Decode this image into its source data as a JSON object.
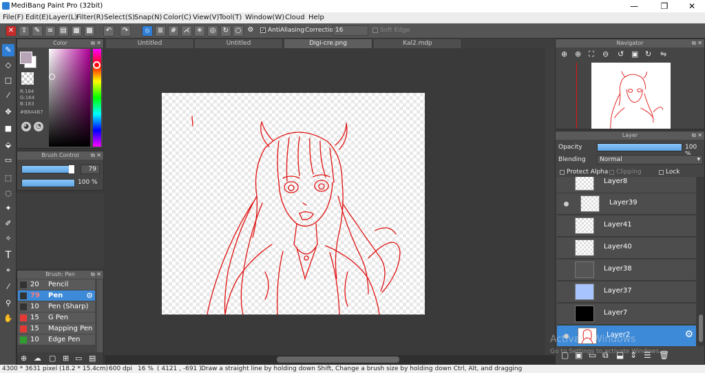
{
  "window": {
    "title": "MediBang Paint Pro (32bit)",
    "minimize": "—",
    "restore": "❐",
    "close": "✕"
  },
  "menu": [
    "File(F)",
    "Edit(E)",
    "Layer(L)",
    "Filter(R)",
    "Select(S)",
    "Snap(N)",
    "Color(C)",
    "View(V)",
    "Tool(T)",
    "Window(W)",
    "Cloud",
    "Help"
  ],
  "toolbar": {
    "antialiasing": "AntiAliasing",
    "correction_label": "Correction",
    "correction_value": "16",
    "soft_edge": "Soft Edge"
  },
  "tabs": [
    "Untitled",
    "Untitled",
    "Digi-cre.png",
    "Kal2.mdp"
  ],
  "active_tab": 2,
  "color_panel": {
    "title": "Color",
    "r": "R:184",
    "g": "G:164",
    "b": "B:183",
    "hex": "#B8A4B7",
    "primary_color": "#B8A4B7"
  },
  "brush_control": {
    "title": "Brush Control",
    "size": "79",
    "opacity": "100 %"
  },
  "brush_panel": {
    "title": "Brush: Pen",
    "items": [
      {
        "size": "20",
        "name": "Pencil",
        "color": "#333333"
      },
      {
        "size": "79",
        "name": "Pen",
        "color": "#333333",
        "active": true
      },
      {
        "size": "10",
        "name": "Pen (Sharp)",
        "color": "#333333"
      },
      {
        "size": "15",
        "name": "G Pen",
        "color": "#e53935"
      },
      {
        "size": "15",
        "name": "Mapping Pen",
        "color": "#e53935"
      },
      {
        "size": "10",
        "name": "Edge Pen",
        "color": "#2e9e2e"
      }
    ]
  },
  "navigator": {
    "title": "Navigator"
  },
  "layer_panel": {
    "title": "Layer",
    "opacity_label": "Opacity",
    "opacity_value": "100 %",
    "opacity_fraction": 1.0,
    "blending_label": "Blending",
    "blending_value": "Normal",
    "protect_alpha": "Protect Alpha",
    "clipping": "Clipping",
    "lock": "Lock",
    "layers": [
      {
        "name": "Layer8",
        "thumb": "checker"
      },
      {
        "name": "Layer39",
        "thumb": "checker",
        "visible_dot": true
      },
      {
        "name": "Layer41",
        "thumb": "checker"
      },
      {
        "name": "Layer40",
        "thumb": "checker"
      },
      {
        "name": "Layer38",
        "thumb": "dark"
      },
      {
        "name": "Layer37",
        "thumb": "#a8c4ff"
      },
      {
        "name": "Layer7",
        "thumb": "#000000"
      },
      {
        "name": "Layer2",
        "thumb": "sketch",
        "active": true,
        "visible_dot": true
      }
    ]
  },
  "watermark": {
    "line1": "Activate Windows",
    "line2": "Go to Settings to activate Windows."
  },
  "status": {
    "size": "4300 * 3631 pixel",
    "physical": "(18.2 * 15.4cm)",
    "dpi": "600 dpi",
    "zoom": "16 %",
    "coords": "( 4121 , -691 )",
    "hint": "Draw a straight line by holding down Shift, Change a brush size by holding down Ctrl, Alt, and dragging"
  },
  "accent_color": "#3d8ad8",
  "sketch_color": "#e01010"
}
